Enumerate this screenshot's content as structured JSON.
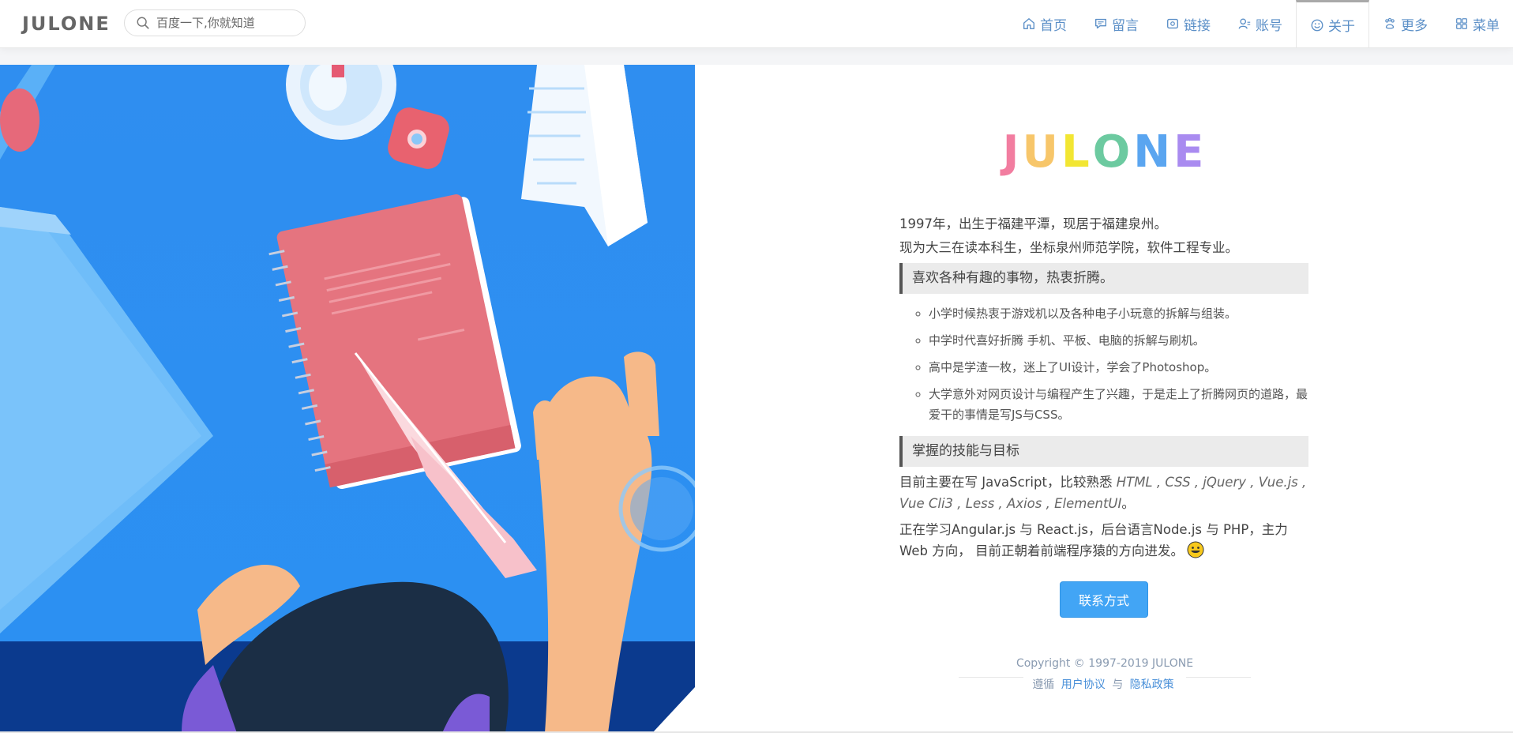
{
  "header": {
    "brand": "JULONE",
    "search_placeholder": "百度一下,你就知道",
    "nav": [
      {
        "label": "首页",
        "icon": "home-icon"
      },
      {
        "label": "留言",
        "icon": "message-icon"
      },
      {
        "label": "链接",
        "icon": "link-icon"
      },
      {
        "label": "账号",
        "icon": "user-icon"
      },
      {
        "label": "关于",
        "icon": "smile-icon",
        "active": true
      },
      {
        "label": "更多",
        "icon": "paw-icon"
      },
      {
        "label": "菜单",
        "icon": "grid-icon"
      }
    ]
  },
  "logo": {
    "letters": [
      "J",
      "U",
      "L",
      "O",
      "N",
      "E"
    ],
    "colors": [
      "#f27da0",
      "#f7c66a",
      "#f7ef3a",
      "#6ccaa0",
      "#5aa5f0",
      "#a98bf0"
    ]
  },
  "about": {
    "intro_1": "1997年，出生于福建平潭，现居于福建泉州。",
    "intro_2": "现为大三在读本科生，坐标泉州师范学院，软件工程专业。",
    "section_hobbies": "喜欢各种有趣的事物，热衷折腾。",
    "hobbies": [
      "小学时候热衷于游戏机以及各种电子小玩意的拆解与组装。",
      "中学时代喜好折腾 手机、平板、电脑的拆解与刷机。",
      "高中是学渣一枚，迷上了UI设计，学会了Photoshop。",
      "大学意外对网页设计与编程产生了兴趣，于是走上了折腾网页的道路，最爱干的事情是写JS与CSS。"
    ],
    "section_skills": "掌握的技能与目标",
    "skills_prefix": "目前主要在写 JavaScript，比较熟悉 ",
    "skills_list": "HTML , CSS , jQuery , Vue.js , Vue Cli3 , Less , Axios , ElementUI",
    "skills_suffix": "。",
    "learning": "正在学习Angular.js 与 React.js，后台语言Node.js 与 PHP，主力Web 方向，  目前正朝着前端程序猿的方向进发。",
    "contact_button": "联系方式"
  },
  "footer": {
    "copyright": "Copyright © 1997-2019 JULONE",
    "follow": "遵循",
    "user_agreement": "用户协议",
    "and": "与",
    "privacy_policy": "隐私政策"
  },
  "colors": {
    "nav_text": "#5b8fc7",
    "accent_button": "#42a5f5",
    "illustration_bg": "#2796f3"
  }
}
